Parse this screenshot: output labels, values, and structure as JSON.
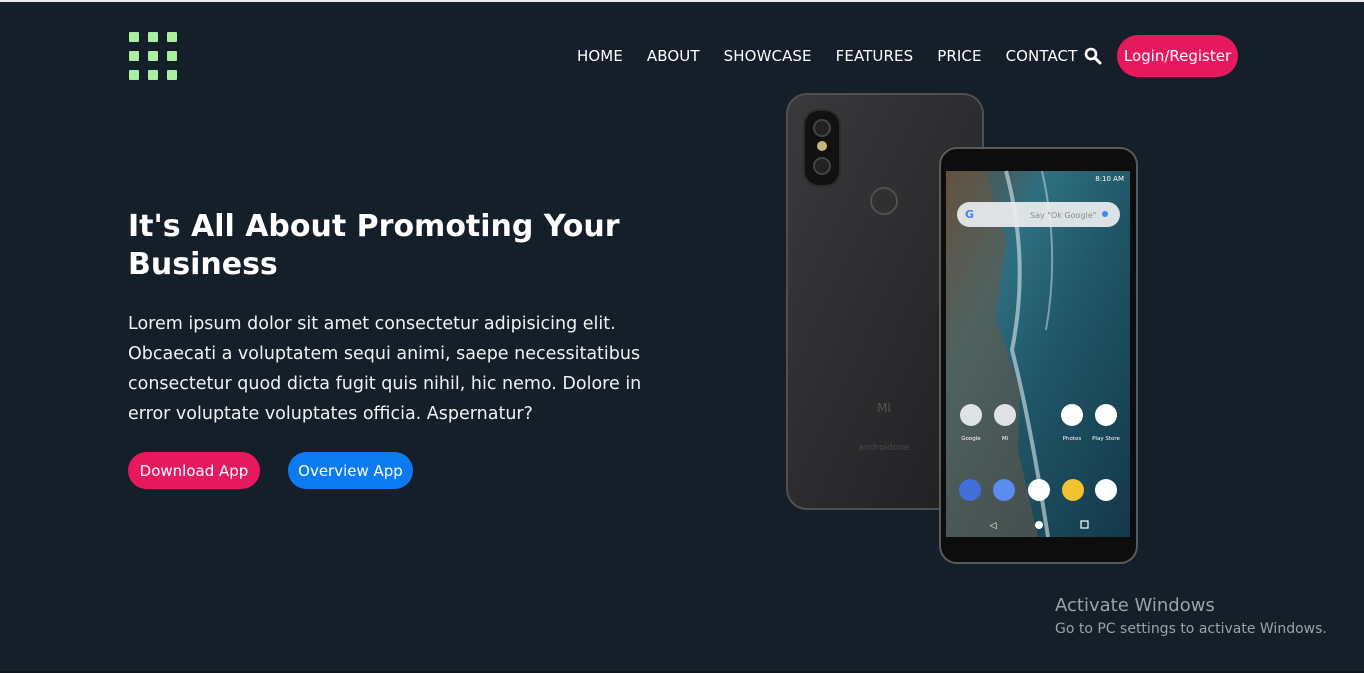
{
  "nav": {
    "items": [
      {
        "label": "HOME"
      },
      {
        "label": "ABOUT"
      },
      {
        "label": "SHOWCASE"
      },
      {
        "label": "FEATURES"
      },
      {
        "label": "PRICE"
      },
      {
        "label": "CONTACT"
      }
    ],
    "login_label": "Login/Register"
  },
  "hero": {
    "title": "It's All About Promoting Your Business",
    "text": "Lorem ipsum dolor sit amet consectetur adipisicing elit. Obcaecati a voluptatem sequi animi, saepe necessitatibus consectetur quod dicta fugit quis nihil, hic nemo. Dolore in error voluptate voluptates officia. Aspernatur?",
    "download_label": "Download App",
    "overview_label": "Overview App"
  },
  "phone": {
    "status_time": "8:10 AM",
    "search_hint": "Say \"Ok Google\"",
    "back_brand": "MI",
    "back_sub": "androidone",
    "apps": [
      "Google",
      "Mi",
      "Photos",
      "Play Store"
    ]
  },
  "watermark": {
    "title": "Activate Windows",
    "subtitle": "Go to PC settings to activate Windows."
  },
  "colors": {
    "background": "#151f29",
    "accent_pink": "#e6195e",
    "accent_blue": "#0d7bf0",
    "logo_green": "#a8f0a0"
  },
  "icons": [
    "grid-logo-icon",
    "search-icon"
  ]
}
